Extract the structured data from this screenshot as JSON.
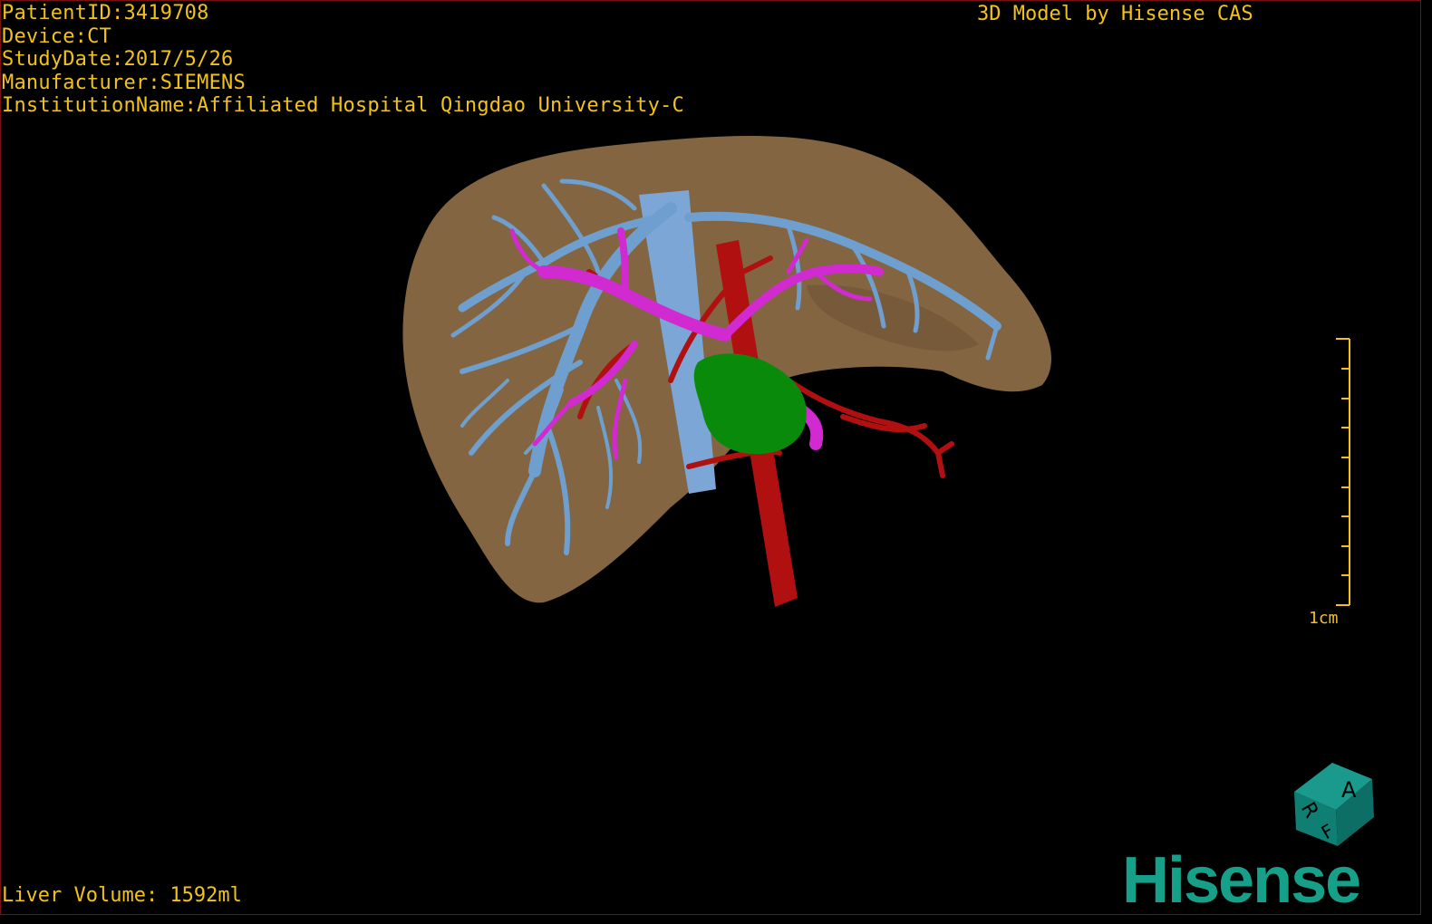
{
  "header": {
    "patient_id": "PatientID:3419708",
    "device": "Device:CT",
    "study_date": "StudyDate:2017/5/26",
    "manufacturer": "Manufacturer:SIEMENS",
    "institution": "InstitutionName:Affiliated Hospital Qingdao University-C"
  },
  "title": "3D Model by Hisense CAS",
  "footer": {
    "liver_volume": "Liver Volume: 1592ml"
  },
  "scale_bar": {
    "label": "1cm"
  },
  "orientation_cube": {
    "labels": [
      "A",
      "R",
      "F"
    ],
    "color": "#0f7f74"
  },
  "logo": {
    "text": "Hisense",
    "color": "#16a08a"
  },
  "colors": {
    "text": "#f2c21a",
    "liver": "#8a6a45",
    "hepatic_vein": "#6f9fcf",
    "portal_vein": "#d02ad0",
    "artery": "#b01010",
    "lesion": "#0a8a0a"
  }
}
